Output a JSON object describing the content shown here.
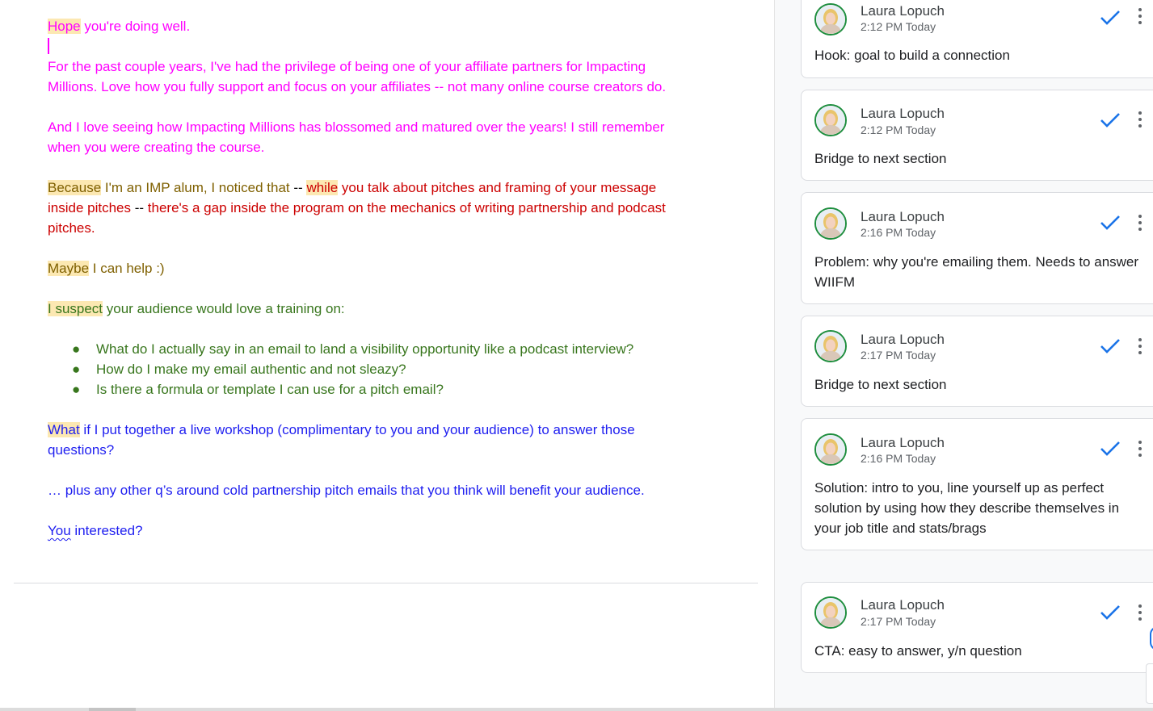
{
  "document": {
    "p1": {
      "hl": "Hope",
      "rest": " you're doing well."
    },
    "p2": "For the past couple years, I've had the privilege of being one of your affiliate partners for Impacting Millions. Love how you fully support and focus on your affiliates -- not many online course creators do.",
    "p3": "And I love seeing how Impacting Millions has blossomed and matured over the years! I still remember when you were creating the course.",
    "p4": {
      "hl1": "Because",
      "olive": " I'm an IMP alum, I noticed that ",
      "dash": "--",
      "space": " ",
      "hl2": "while",
      "red": " you talk about pitches and framing of your message inside pitches ",
      "dash2": "--",
      "red2": " there's a gap inside the program on the mechanics of writing partnership and podcast pitches."
    },
    "p5": {
      "hl": "Maybe",
      "rest": " I can help :)"
    },
    "p6": {
      "hl": "I suspect",
      "rest": " your audience would love a training on:"
    },
    "bullet_glyph": "●",
    "bullets": [
      "What do I actually say in an email to land a visibility opportunity like a podcast interview?",
      "How do I make my email authentic and not sleazy?",
      "Is there a formula or template I can use for a pitch email?"
    ],
    "p7": {
      "hl": "What",
      "rest": " if I put together a live workshop (complimentary to you and your audience) to answer those questions?"
    },
    "p8": "… plus any other q’s around cold partnership pitch emails that you think will benefit your audience.",
    "p9": {
      "misspelled": "You",
      "rest": " interested?"
    }
  },
  "comments": [
    {
      "author": "Laura Lopuch",
      "time": "2:12 PM Today",
      "text": "Hook: goal to build a connection"
    },
    {
      "author": "Laura Lopuch",
      "time": "2:12 PM Today",
      "text": "Bridge to next section"
    },
    {
      "author": "Laura Lopuch",
      "time": "2:16 PM Today",
      "text": "Problem: why you're emailing them. Needs to answer WIIFM"
    },
    {
      "author": "Laura Lopuch",
      "time": "2:17 PM Today",
      "text": "Bridge to next section"
    },
    {
      "author": "Laura Lopuch",
      "time": "2:16 PM Today",
      "text": "Solution: intro to you, line yourself up as perfect solution by using how they describe themselves in your job title and stats/brags"
    },
    {
      "author": "Laura Lopuch",
      "time": "2:17 PM Today",
      "text": "CTA: easy to answer, y/n question"
    }
  ],
  "colors": {
    "accent": "#1a73e8",
    "highlight": "#fce8b2",
    "avatar_ring": "#1e8e3e"
  },
  "icons": {
    "resolve": "check-icon",
    "menu": "more-vert-icon",
    "avatar": "avatar-icon"
  }
}
